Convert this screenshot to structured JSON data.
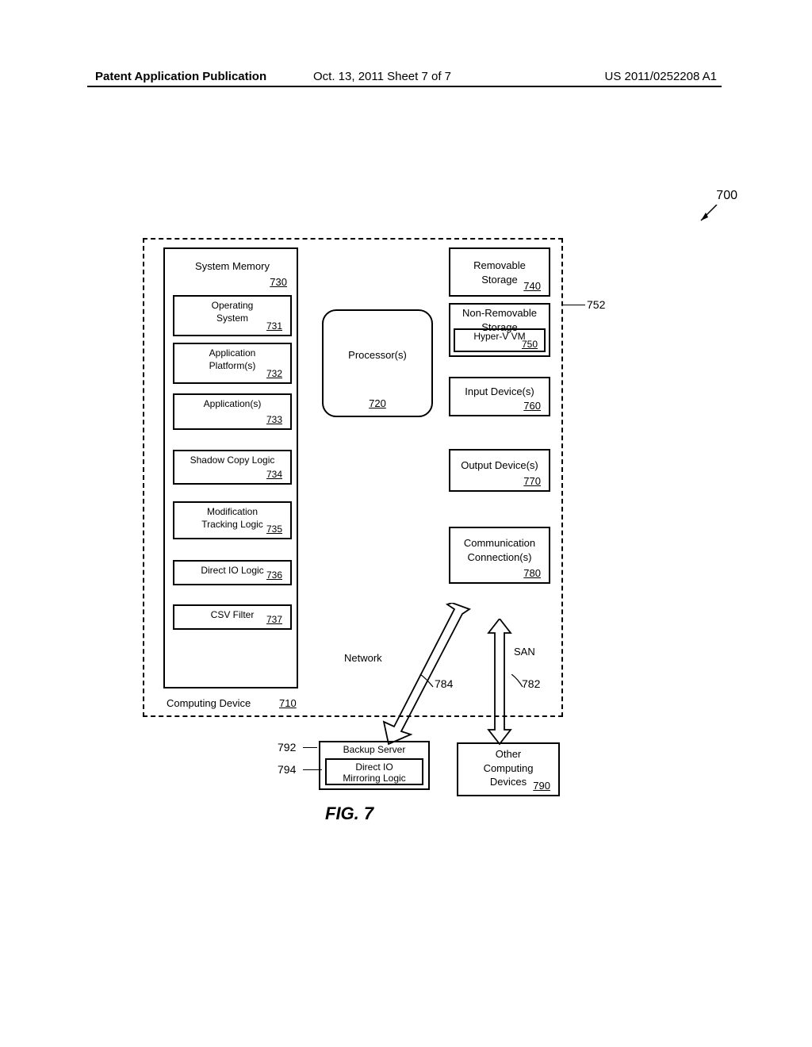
{
  "header": {
    "left": "Patent Application Publication",
    "center": "Oct. 13, 2011  Sheet 7 of 7",
    "right": "US 2011/0252208 A1"
  },
  "ref": {
    "r700": "700",
    "r752": "752",
    "r792": "792",
    "r794": "794",
    "r784": "784",
    "r782": "782"
  },
  "memory": {
    "label": "System Memory",
    "num": "730",
    "os": {
      "label": "Operating\nSystem",
      "num": "731"
    },
    "platform": {
      "label": "Application\nPlatform(s)",
      "num": "732"
    },
    "apps": {
      "label": "Application(s)",
      "num": "733"
    },
    "shadow": {
      "label": "Shadow Copy Logic",
      "num": "734"
    },
    "mod": {
      "label": "Modification\nTracking Logic",
      "num": "735"
    },
    "direct": {
      "label": "Direct IO Logic",
      "num": "736"
    },
    "csv": {
      "label": "CSV Filter",
      "num": "737"
    }
  },
  "processor": {
    "label": "Processor(s)",
    "num": "720"
  },
  "right": {
    "removable": {
      "label": "Removable\nStorage",
      "num": "740"
    },
    "nonremovable": {
      "label": "Non-Removable\nStorage",
      "hyperv": "Hyper-V VM",
      "hyperv_num": "750"
    },
    "input": {
      "label": "Input Device(s)",
      "num": "760"
    },
    "output": {
      "label": "Output Device(s)",
      "num": "770"
    },
    "comm": {
      "label": "Communication\nConnection(s)",
      "num": "780"
    }
  },
  "device": {
    "label": "Computing Device",
    "num": "710"
  },
  "backup": {
    "label": "Backup Server",
    "mirror": "Direct IO\nMirroring Logic"
  },
  "other": {
    "label": "Other\nComputing\nDevices",
    "num": "790"
  },
  "connectors": {
    "network": "Network",
    "san": "SAN"
  },
  "figure": "FIG. 7"
}
